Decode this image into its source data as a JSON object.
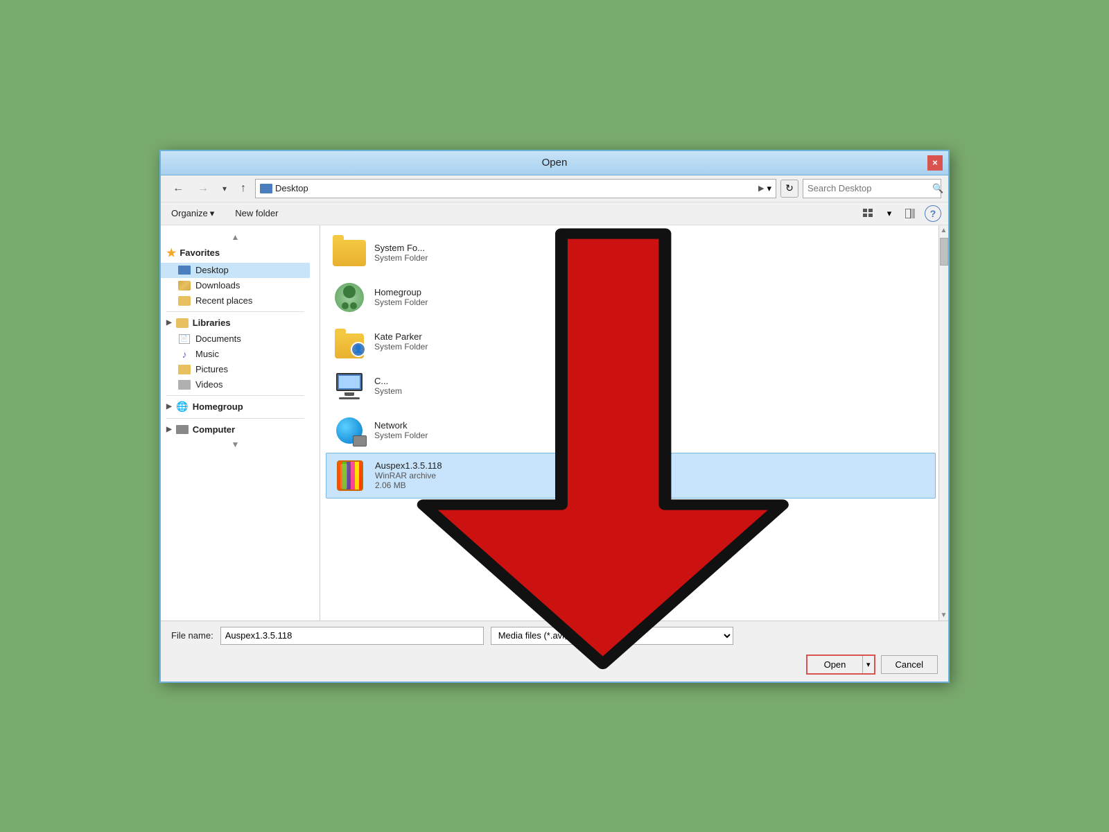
{
  "titleBar": {
    "title": "Open",
    "closeLabel": "×"
  },
  "toolbar": {
    "backBtn": "←",
    "forwardBtn": "→",
    "dropdownBtn": "▾",
    "upBtn": "↑",
    "pathText": "Desktop",
    "pathArrow": "▶",
    "refreshBtn": "↻",
    "searchPlaceholder": "Search Desktop",
    "searchIcon": "🔍"
  },
  "organizeBar": {
    "organizeLabel": "Organize",
    "organizeArrow": "▾",
    "newFolderLabel": "New folder",
    "viewIcon": "⊞",
    "helpIcon": "?"
  },
  "sidebar": {
    "favoritesLabel": "Favorites",
    "favoritesIcon": "★",
    "items": [
      {
        "label": "Desktop",
        "type": "desktop",
        "selected": true
      },
      {
        "label": "Downloads",
        "type": "downloads"
      },
      {
        "label": "Recent places",
        "type": "recent"
      }
    ],
    "librariesLabel": "Libraries",
    "libItems": [
      {
        "label": "Documents",
        "type": "documents"
      },
      {
        "label": "Music",
        "type": "music"
      },
      {
        "label": "Pictures",
        "type": "pictures"
      },
      {
        "label": "Videos",
        "type": "videos"
      }
    ],
    "homegroupLabel": "Homegroup",
    "computerLabel": "Computer"
  },
  "files": [
    {
      "name": "System Fo...",
      "type": "System Folder",
      "size": "",
      "iconType": "system-folder"
    },
    {
      "name": "Homegroup",
      "type": "System Folder",
      "size": "",
      "iconType": "homegroup"
    },
    {
      "name": "Kate Parker",
      "type": "System Folder",
      "size": "",
      "iconType": "person-folder"
    },
    {
      "name": "C...",
      "type": "System",
      "size": "",
      "iconType": "computer"
    },
    {
      "name": "Network",
      "type": "System Folder",
      "size": "",
      "iconType": "network"
    },
    {
      "name": "Auspex1.3.5.118",
      "type": "WinRAR archive",
      "size": "2.06 MB",
      "iconType": "winrar",
      "selected": true
    }
  ],
  "bottomBar": {
    "fileNameLabel": "File name:",
    "fileNameValue": "Auspex1.3.5.118",
    "fileTypeValue": "Media files (*.avi,*.wmv,*.mpg",
    "openLabel": "Open",
    "openDropdownArrow": "▾",
    "cancelLabel": "Cancel"
  }
}
